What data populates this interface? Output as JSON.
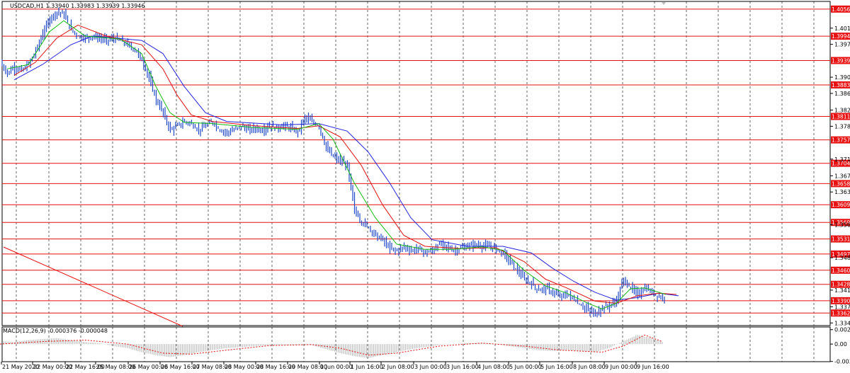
{
  "window": {
    "symbol_header": "USDCAD,H1  1.33940 1.33983 1.33939 1.33946"
  },
  "colors": {
    "background": "#ffffff",
    "grid": "#000000",
    "candles": "#1f48c8",
    "level_line": "#e81010",
    "level_label_bg": "#e81010",
    "level_label_text": "#ffffff",
    "ma_fast": "#11bb11",
    "ma_mid": "#e01010",
    "ma_slow": "#2222dd",
    "macd_hist": "#bfbfbf",
    "macd_signal": "#e01010"
  },
  "chart_data": [
    {
      "type": "line",
      "title": "USDCAD,H1  1.33940 1.33983 1.33939 1.33946",
      "ylim": [
        1.3334,
        1.4074
      ],
      "price_ticks": [
        "1.40130",
        "1.39760",
        "1.39010",
        "1.38640",
        "1.38260",
        "1.37890",
        "1.37140",
        "1.36760",
        "1.36390",
        "1.35640",
        "1.34890",
        "1.34150",
        "1.33770",
        "1.33400"
      ],
      "horizontal_levels": [
        "1.40565",
        "1.39946",
        "1.39391",
        "1.38834",
        "1.38114",
        "1.37579",
        "1.37045",
        "1.36581",
        "1.36099",
        "1.35695",
        "1.35318",
        "1.34973",
        "1.34604",
        "1.34282",
        "1.33908",
        "1.33626"
      ],
      "time_labels": [
        "21 May 2020",
        "22 May 00:00",
        "22 May 16:00",
        "25 May 08:00",
        "26 May 00:00",
        "26 May 16:00",
        "27 May 08:00",
        "28 May 00:00",
        "28 May 16:00",
        "29 May 08:00",
        "1 Jun 00:00",
        "1 Jun 16:00",
        "2 Jun 08:00",
        "3 Jun 00:00",
        "3 Jun 16:00",
        "4 Jun 08:00",
        "5 Jun 00:00",
        "5 Jun 16:00",
        "8 Jun 08:00",
        "9 Jun 00:00",
        "9 Jun 16:00"
      ],
      "close_path": [
        [
          0,
          1.3935
        ],
        [
          10,
          1.391
        ],
        [
          20,
          1.3925
        ],
        [
          30,
          1.3915
        ],
        [
          40,
          1.393
        ],
        [
          50,
          1.396
        ],
        [
          60,
          1.4
        ],
        [
          70,
          1.4035
        ],
        [
          80,
          1.405
        ],
        [
          90,
          1.4045
        ],
        [
          100,
          1.401
        ],
        [
          110,
          1.3995
        ],
        [
          120,
          1.399
        ],
        [
          130,
          1.3995
        ],
        [
          140,
          1.399
        ],
        [
          150,
          1.3985
        ],
        [
          160,
          1.399
        ],
        [
          170,
          1.3985
        ],
        [
          180,
          1.3975
        ],
        [
          190,
          1.3965
        ],
        [
          200,
          1.394
        ],
        [
          210,
          1.39
        ],
        [
          220,
          1.385
        ],
        [
          230,
          1.382
        ],
        [
          240,
          1.378
        ],
        [
          250,
          1.379
        ],
        [
          260,
          1.38
        ],
        [
          270,
          1.3795
        ],
        [
          280,
          1.378
        ],
        [
          290,
          1.379
        ],
        [
          300,
          1.38
        ],
        [
          310,
          1.378
        ],
        [
          320,
          1.3775
        ],
        [
          330,
          1.378
        ],
        [
          340,
          1.379
        ],
        [
          350,
          1.378
        ],
        [
          360,
          1.3785
        ],
        [
          370,
          1.378
        ],
        [
          380,
          1.379
        ],
        [
          390,
          1.3785
        ],
        [
          400,
          1.379
        ],
        [
          410,
          1.3785
        ],
        [
          420,
          1.3775
        ],
        [
          430,
          1.381
        ],
        [
          440,
          1.38
        ],
        [
          450,
          1.379
        ],
        [
          460,
          1.374
        ],
        [
          470,
          1.372
        ],
        [
          480,
          1.371
        ],
        [
          490,
          1.37
        ],
        [
          500,
          1.36
        ],
        [
          510,
          1.357
        ],
        [
          520,
          1.356
        ],
        [
          530,
          1.354
        ],
        [
          540,
          1.353
        ],
        [
          550,
          1.351
        ],
        [
          560,
          1.3505
        ],
        [
          570,
          1.3515
        ],
        [
          580,
          1.3505
        ],
        [
          590,
          1.351
        ],
        [
          600,
          1.35
        ],
        [
          610,
          1.3505
        ],
        [
          620,
          1.352
        ],
        [
          630,
          1.3515
        ],
        [
          640,
          1.3505
        ],
        [
          650,
          1.351
        ],
        [
          660,
          1.3515
        ],
        [
          670,
          1.352
        ],
        [
          680,
          1.3515
        ],
        [
          690,
          1.3515
        ],
        [
          700,
          1.351
        ],
        [
          710,
          1.35
        ],
        [
          720,
          1.348
        ],
        [
          730,
          1.346
        ],
        [
          740,
          1.344
        ],
        [
          750,
          1.343
        ],
        [
          760,
          1.3415
        ],
        [
          770,
          1.342
        ],
        [
          780,
          1.341
        ],
        [
          790,
          1.34
        ],
        [
          800,
          1.3405
        ],
        [
          810,
          1.3395
        ],
        [
          820,
          1.338
        ],
        [
          830,
          1.337
        ],
        [
          840,
          1.336
        ],
        [
          850,
          1.3375
        ],
        [
          860,
          1.338
        ],
        [
          870,
          1.339
        ],
        [
          880,
          1.344
        ],
        [
          890,
          1.342
        ],
        [
          900,
          1.3405
        ],
        [
          910,
          1.342
        ],
        [
          920,
          1.341
        ],
        [
          930,
          1.34
        ],
        [
          940,
          1.3395
        ]
      ],
      "ma_fast_path": [
        [
          10,
          1.392
        ],
        [
          40,
          1.393
        ],
        [
          70,
          1.4005
        ],
        [
          90,
          1.403
        ],
        [
          120,
          1.3995
        ],
        [
          170,
          1.3988
        ],
        [
          200,
          1.3955
        ],
        [
          220,
          1.388
        ],
        [
          240,
          1.382
        ],
        [
          260,
          1.3798
        ],
        [
          300,
          1.3795
        ],
        [
          360,
          1.3786
        ],
        [
          420,
          1.3782
        ],
        [
          450,
          1.3795
        ],
        [
          470,
          1.376
        ],
        [
          500,
          1.366
        ],
        [
          530,
          1.358
        ],
        [
          560,
          1.352
        ],
        [
          600,
          1.3508
        ],
        [
          640,
          1.3508
        ],
        [
          680,
          1.3514
        ],
        [
          710,
          1.3506
        ],
        [
          740,
          1.346
        ],
        [
          770,
          1.3425
        ],
        [
          800,
          1.3408
        ],
        [
          830,
          1.3385
        ],
        [
          850,
          1.3372
        ],
        [
          870,
          1.3385
        ],
        [
          890,
          1.3418
        ],
        [
          910,
          1.342
        ],
        [
          940,
          1.3405
        ]
      ],
      "ma_mid_path": [
        [
          20,
          1.3905
        ],
        [
          50,
          1.3935
        ],
        [
          80,
          1.399
        ],
        [
          110,
          1.402
        ],
        [
          150,
          1.3995
        ],
        [
          200,
          1.3975
        ],
        [
          230,
          1.392
        ],
        [
          250,
          1.386
        ],
        [
          270,
          1.3815
        ],
        [
          300,
          1.38
        ],
        [
          360,
          1.379
        ],
        [
          420,
          1.3784
        ],
        [
          450,
          1.379
        ],
        [
          480,
          1.3765
        ],
        [
          510,
          1.37
        ],
        [
          540,
          1.361
        ],
        [
          570,
          1.354
        ],
        [
          600,
          1.3515
        ],
        [
          650,
          1.351
        ],
        [
          700,
          1.3512
        ],
        [
          740,
          1.348
        ],
        [
          770,
          1.344
        ],
        [
          800,
          1.342
        ],
        [
          840,
          1.339
        ],
        [
          870,
          1.3385
        ],
        [
          900,
          1.3402
        ],
        [
          930,
          1.3408
        ],
        [
          955,
          1.3405
        ]
      ],
      "ma_slow_path": [
        [
          20,
          1.3895
        ],
        [
          60,
          1.393
        ],
        [
          100,
          1.3975
        ],
        [
          130,
          1.3995
        ],
        [
          200,
          1.3985
        ],
        [
          230,
          1.3955
        ],
        [
          260,
          1.388
        ],
        [
          290,
          1.382
        ],
        [
          320,
          1.38
        ],
        [
          400,
          1.3792
        ],
        [
          450,
          1.3795
        ],
        [
          490,
          1.3778
        ],
        [
          520,
          1.373
        ],
        [
          550,
          1.366
        ],
        [
          580,
          1.358
        ],
        [
          610,
          1.353
        ],
        [
          660,
          1.3515
        ],
        [
          710,
          1.3515
        ],
        [
          750,
          1.35
        ],
        [
          780,
          1.3465
        ],
        [
          810,
          1.3435
        ],
        [
          840,
          1.341
        ],
        [
          870,
          1.3392
        ],
        [
          900,
          1.3398
        ],
        [
          930,
          1.3408
        ],
        [
          958,
          1.3402
        ]
      ]
    },
    {
      "type": "line",
      "title": "MACD(12,26,9) -0.000376 -0.000048",
      "ylim": [
        -0.0035,
        0.0034
      ],
      "ticks": [
        "0.002876",
        "0.00",
        "-0.003456"
      ],
      "signal_path": [
        [
          0,
          0.0
        ],
        [
          60,
          0.0005
        ],
        [
          120,
          0.0008
        ],
        [
          180,
          0.0
        ],
        [
          230,
          -0.0018
        ],
        [
          270,
          -0.002
        ],
        [
          320,
          -0.0012
        ],
        [
          380,
          -0.0003
        ],
        [
          440,
          -0.0001
        ],
        [
          480,
          -0.0008
        ],
        [
          520,
          -0.0022
        ],
        [
          560,
          -0.0018
        ],
        [
          620,
          -0.0004
        ],
        [
          680,
          0.0002
        ],
        [
          740,
          -0.0004
        ],
        [
          790,
          -0.0012
        ],
        [
          850,
          -0.0016
        ],
        [
          880,
          -0.0004
        ],
        [
          910,
          0.0018
        ],
        [
          935,
          0.0005
        ]
      ],
      "histogram": [
        [
          0,
          0.0006
        ],
        [
          20,
          0.0004
        ],
        [
          40,
          0.0008
        ],
        [
          60,
          0.001
        ],
        [
          80,
          0.0012
        ],
        [
          100,
          0.0008
        ],
        [
          120,
          0.0004
        ],
        [
          140,
          0.0002
        ],
        [
          160,
          -0.0004
        ],
        [
          180,
          -0.0008
        ],
        [
          200,
          -0.0016
        ],
        [
          220,
          -0.0022
        ],
        [
          240,
          -0.0026
        ],
        [
          260,
          -0.0022
        ],
        [
          280,
          -0.0016
        ],
        [
          300,
          -0.0012
        ],
        [
          320,
          -0.0008
        ],
        [
          340,
          -0.0006
        ],
        [
          360,
          -0.0004
        ],
        [
          380,
          -0.0003
        ],
        [
          400,
          -0.0002
        ],
        [
          420,
          -0.0002
        ],
        [
          440,
          -0.0002
        ],
        [
          460,
          -0.001
        ],
        [
          480,
          -0.0018
        ],
        [
          500,
          -0.0024
        ],
        [
          520,
          -0.0028
        ],
        [
          540,
          -0.0022
        ],
        [
          560,
          -0.0016
        ],
        [
          580,
          -0.001
        ],
        [
          600,
          -0.0006
        ],
        [
          620,
          -0.0002
        ],
        [
          640,
          0.0
        ],
        [
          660,
          0.0002
        ],
        [
          680,
          0.0002
        ],
        [
          700,
          0.0
        ],
        [
          720,
          -0.0004
        ],
        [
          740,
          -0.0008
        ],
        [
          760,
          -0.0012
        ],
        [
          780,
          -0.0014
        ],
        [
          800,
          -0.0012
        ],
        [
          820,
          -0.0014
        ],
        [
          840,
          -0.0016
        ],
        [
          860,
          -0.0008
        ],
        [
          880,
          0.0006
        ],
        [
          900,
          0.0018
        ],
        [
          920,
          0.0012
        ],
        [
          935,
          0.0004
        ]
      ]
    }
  ]
}
